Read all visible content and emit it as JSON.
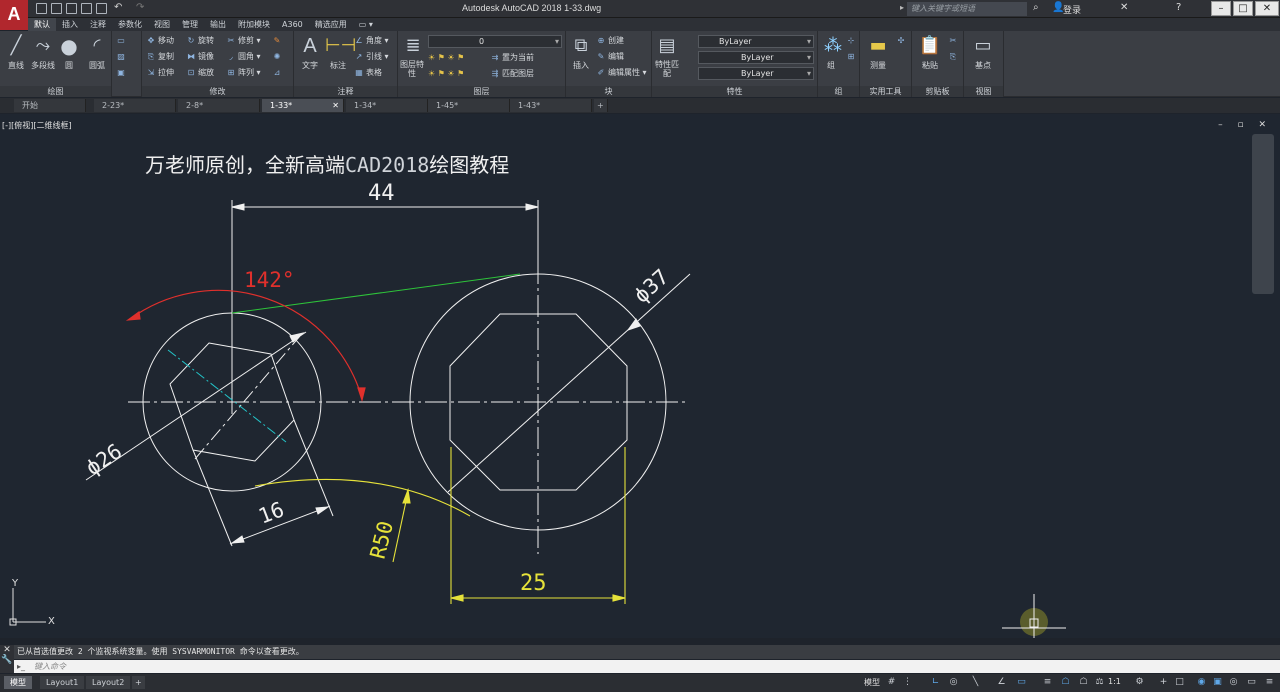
{
  "title_bar": {
    "window_title": "Autodesk AutoCAD 2018    1-33.dwg",
    "search_placeholder": "键入关键字或短语",
    "login_label": "登录",
    "app_logo": "A"
  },
  "ribbon_tabs": [
    "默认",
    "插入",
    "注释",
    "参数化",
    "视图",
    "管理",
    "输出",
    "附加模块",
    "A360",
    "精选应用"
  ],
  "ribbon": {
    "draw": {
      "title": "绘图",
      "line": "直线",
      "polyline": "多段线",
      "circle": "圆",
      "arc": "圆弧"
    },
    "modify": {
      "title": "修改",
      "items": [
        "移动",
        "旋转",
        "修剪",
        "复制",
        "镜像",
        "圆角",
        "拉伸",
        "缩放",
        "阵列"
      ]
    },
    "annotation": {
      "title": "注释",
      "text": "文字",
      "dimension": "标注",
      "items": [
        "角度",
        "引线",
        "表格"
      ]
    },
    "layers": {
      "title": "图层",
      "properties": "图层特性",
      "current_layer": "0",
      "items": [
        "置为当前",
        "匹配图层"
      ]
    },
    "block": {
      "title": "块",
      "insert": "插入",
      "items": [
        "创建",
        "编辑",
        "编辑属性"
      ]
    },
    "properties": {
      "title": "特性",
      "match": "特性匹配",
      "color": "ByLayer",
      "linetype": "ByLayer",
      "lineweight": "ByLayer"
    },
    "groups": {
      "title": "组",
      "group": "组"
    },
    "utilities": {
      "title": "实用工具",
      "measure": "测量"
    },
    "clipboard": {
      "title": "剪贴板",
      "paste": "粘贴"
    },
    "view": {
      "title": "视图",
      "base": "基点"
    }
  },
  "doc_tabs": [
    "开始",
    "2-23*",
    "2-8*",
    "1-33*",
    "1-34*",
    "1-45*",
    "1-43*"
  ],
  "active_doc_tab": "1-33*",
  "viewport_label": "[-][俯视][二维线框]",
  "drawing": {
    "heading_cn": "万老师原创，全新高端",
    "heading_cad": "CAD2018",
    "heading_tail": "绘图教程",
    "dim_44": "44",
    "dim_angle": "142°",
    "dim_d37": "ϕ37",
    "dim_d26": "ϕ26",
    "dim_16": "16",
    "dim_r50": "R50",
    "dim_25": "25",
    "ucs_x": "X",
    "ucs_y": "Y"
  },
  "command": {
    "history": "已从首选值更改 2 个监视系统变量。使用 SYSVARMONITOR 命令以查看更改。",
    "placeholder": "键入命令"
  },
  "status": {
    "layout_tabs": [
      "模型",
      "Layout1",
      "Layout2"
    ],
    "model_label": "模型",
    "scale": "1:1"
  },
  "colors": {
    "canvas_bg": "#1f2630",
    "white_geom": "#f0f0f0",
    "red_dim": "#e0302c",
    "green_line": "#2ec43a",
    "yellow_dim": "#e6e23a",
    "cyan_center": "#23c4c8"
  }
}
